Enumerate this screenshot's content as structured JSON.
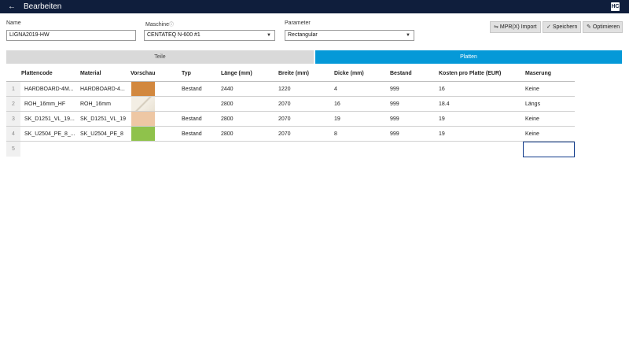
{
  "header": {
    "back_icon": "arrow-left-icon",
    "title": "Bearbeiten",
    "logo_text": "HC"
  },
  "form": {
    "name_label": "Name",
    "name_value": "LIGNA2019-HW",
    "machine_label": "Maschine",
    "machine_info": "ⓘ",
    "machine_value": "CENTATEQ N-600 #1",
    "parameter_label": "Parameter",
    "parameter_value": "Rectangular"
  },
  "toolbar": {
    "import_label": "MPR(X) Import",
    "save_label": "Speichern",
    "optimize_label": "Optimieren"
  },
  "tabs": {
    "teile": "Teile",
    "platten": "Platten",
    "active": "platten"
  },
  "table": {
    "headers": [
      "Plattencode",
      "Material",
      "Vorschau",
      "Typ",
      "Länge (mm)",
      "Breite (mm)",
      "Dicke (mm)",
      "Bestand",
      "Kosten pro Platte (EUR)",
      "Maserung"
    ],
    "rows": [
      {
        "num": "1",
        "code": "HARDBOARD-4M...",
        "material": "HARDBOARD-4...",
        "preview_color": "#d2883f",
        "typ": "Bestand",
        "laenge": "2440",
        "breite": "1220",
        "dicke": "4",
        "bestand": "999",
        "kosten": "16",
        "maserung": "Keine"
      },
      {
        "num": "2",
        "code": "ROH_16mm_HF",
        "material": "ROH_16mm",
        "preview_color": "#ece6d8",
        "typ": "",
        "laenge": "2800",
        "breite": "2070",
        "dicke": "16",
        "bestand": "999",
        "kosten": "18.4",
        "maserung": "Längs"
      },
      {
        "num": "3",
        "code": "SK_D1251_VL_19...",
        "material": "SK_D1251_VL_19",
        "preview_color": "#eec7a4",
        "typ": "Bestand",
        "laenge": "2800",
        "breite": "2070",
        "dicke": "19",
        "bestand": "999",
        "kosten": "19",
        "maserung": "Keine"
      },
      {
        "num": "4",
        "code": "SK_U2504_PE_8_...",
        "material": "SK_U2504_PE_8",
        "preview_color": "#8fc24b",
        "typ": "Bestand",
        "laenge": "2800",
        "breite": "2070",
        "dicke": "8",
        "bestand": "999",
        "kosten": "19",
        "maserung": "Keine"
      },
      {
        "num": "5"
      }
    ]
  }
}
